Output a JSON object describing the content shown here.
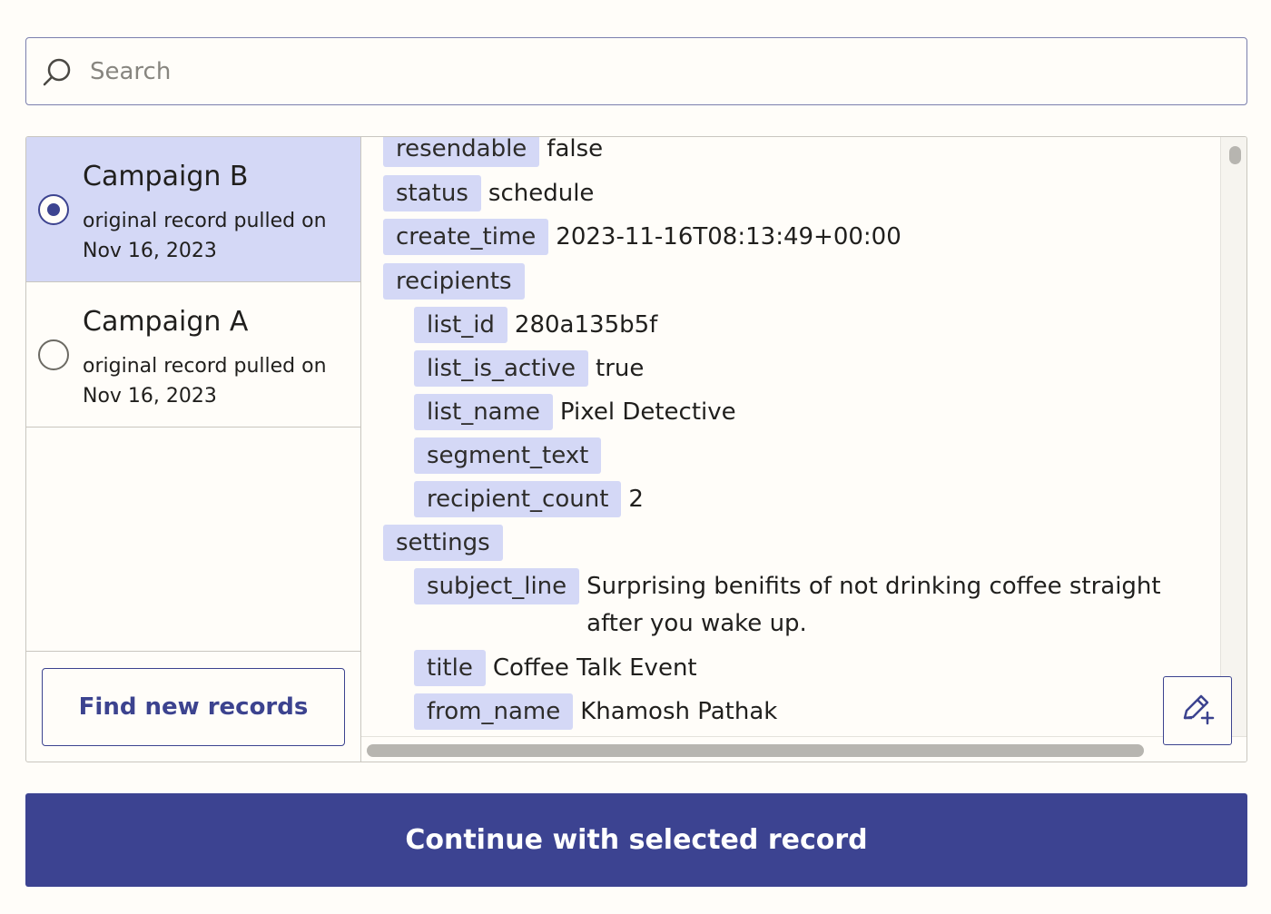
{
  "search": {
    "placeholder": "Search",
    "icon": "search-icon"
  },
  "records": [
    {
      "name": "Campaign B",
      "line1": "original record pulled on",
      "line2": "Nov 16, 2023",
      "selected": true
    },
    {
      "name": "Campaign A",
      "line1": "original record pulled on",
      "line2": "Nov 16, 2023",
      "selected": false
    }
  ],
  "find_button": {
    "label": "Find new records"
  },
  "fields": [
    {
      "key": "resendable",
      "value": "false"
    },
    {
      "key": "status",
      "value": "schedule"
    },
    {
      "key": "create_time",
      "value": "2023-11-16T08:13:49+00:00"
    },
    {
      "key": "recipients",
      "value": ""
    },
    {
      "key": "list_id",
      "value": "280a135b5f"
    },
    {
      "key": "list_is_active",
      "value": "true"
    },
    {
      "key": "list_name",
      "value": "Pixel Detective"
    },
    {
      "key": "segment_text",
      "value": ""
    },
    {
      "key": "recipient_count",
      "value": "2"
    },
    {
      "key": "settings",
      "value": ""
    },
    {
      "key": "subject_line",
      "value": "Surprising benifits of not drinking coffee straight after you wake up."
    },
    {
      "key": "title",
      "value": "Coffee Talk Event"
    },
    {
      "key": "from_name",
      "value": "Khamosh Pathak"
    }
  ],
  "edit_button": {
    "icon": "edit-add-icon"
  },
  "continue_button": {
    "label": "Continue with selected record"
  },
  "colors": {
    "accent": "#3c4391",
    "selected_bg": "#d4d8f6",
    "key_bg": "#d4d8f6",
    "page_bg": "#fffdf9"
  }
}
